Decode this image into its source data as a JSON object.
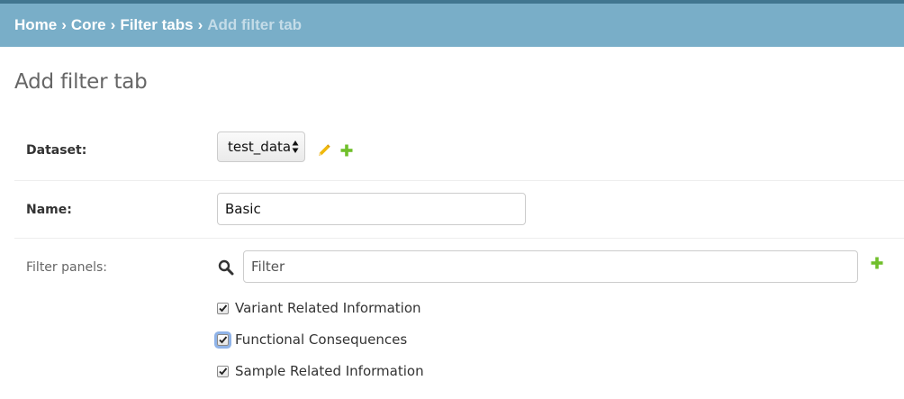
{
  "breadcrumb": {
    "items": [
      "Home",
      "Core",
      "Filter tabs"
    ],
    "separator": "›",
    "current": "Add filter tab"
  },
  "page": {
    "title": "Add filter tab"
  },
  "form": {
    "dataset": {
      "label": "Dataset:",
      "selected": "test_data",
      "change_icon": "pencil-icon",
      "add_icon": "plus-icon"
    },
    "name": {
      "label": "Name:",
      "value": "Basic"
    },
    "filter_panels": {
      "label": "Filter panels:",
      "filter_placeholder": "Filter",
      "search_icon": "search-icon",
      "add_icon": "plus-icon",
      "options": [
        {
          "label": "Variant Related Information",
          "checked": true
        },
        {
          "label": "Functional Consequences",
          "checked": true
        },
        {
          "label": "Sample Related Information",
          "checked": true
        }
      ]
    }
  },
  "colors": {
    "header_bg": "#79aec8",
    "header_border": "#417690",
    "current_crumb": "#c4dce8",
    "pencil": "#efb80b",
    "plus": "#70bf2b"
  }
}
